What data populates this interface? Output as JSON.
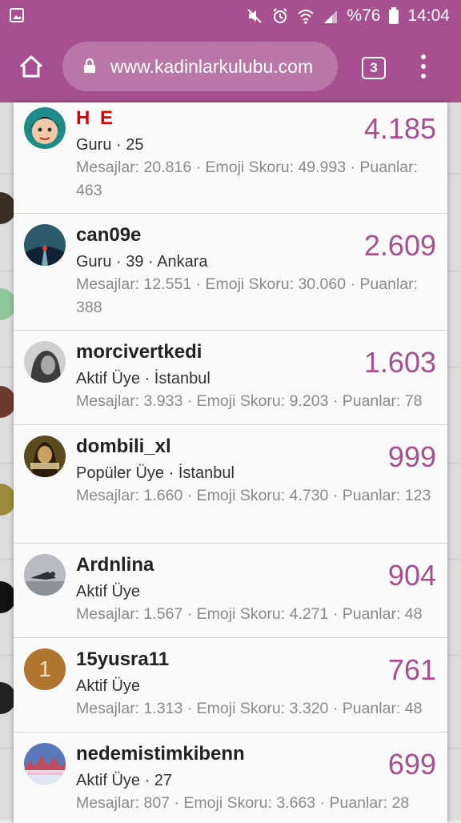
{
  "status_bar": {
    "battery": "%76",
    "time": "14:04",
    "icons": [
      "gallery-icon",
      "mute-icon",
      "alarm-icon",
      "wifi-icon",
      "signal-icon",
      "battery-icon"
    ]
  },
  "browser": {
    "url": "www.kadinlarkulubu.com",
    "tab_count": "3",
    "colors": {
      "toolbar": "#a6508f",
      "accent": "#a6508f"
    }
  },
  "members": [
    {
      "username": "H E",
      "meta": "Guru · 25",
      "stats": "Mesajlar: 20.816 · Emoji Skoru: 49.993 · Puanlar: 463",
      "score": "4.185"
    },
    {
      "username": "can09e",
      "meta": "Guru · 39 · Ankara",
      "stats": "Mesajlar: 12.551 · Emoji Skoru: 30.060 · Puanlar: 388",
      "score": "2.609"
    },
    {
      "username": "morcivertkedi",
      "meta": "Aktif Üye · İstanbul",
      "stats": "Mesajlar: 3.933 · Emoji Skoru: 9.203 · Puanlar: 78",
      "score": "1.603"
    },
    {
      "username": "dombili_xl",
      "meta": "Popüler Üye · İstanbul",
      "stats": "Mesajlar: 1.660 · Emoji Skoru: 4.730 · Puanlar: 123",
      "score": "999"
    },
    {
      "username": "Ardnlina",
      "meta": "Aktif Üye",
      "stats": "Mesajlar: 1.567 · Emoji Skoru: 4.271 · Puanlar: 48",
      "score": "904"
    },
    {
      "username": "15yusra11",
      "meta": "Aktif Üye",
      "stats": "Mesajlar: 1.313 · Emoji Skoru: 3.320 · Puanlar: 48",
      "score": "761",
      "avatar_letter": "1"
    },
    {
      "username": "nedemistimkibenn",
      "meta": "Aktif Üye · 27",
      "stats": "Mesajlar: 807 · Emoji Skoru: 3.663 · Puanlar: 28",
      "score": "699"
    }
  ]
}
